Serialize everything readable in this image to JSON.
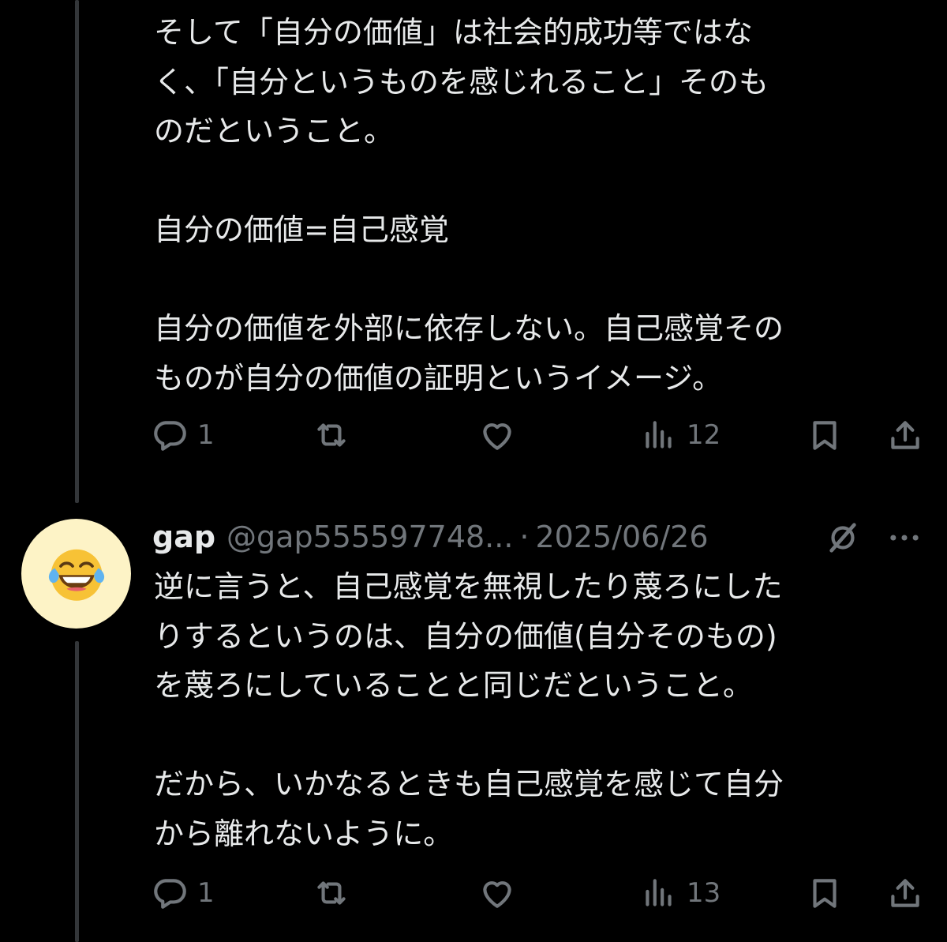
{
  "posts": [
    {
      "text": "そして「自分の価値」は社会的成功等ではな\nく、「自分というものを感じれること」そのも\nのだということ。\n\n自分の価値=自己感覚\n\n自分の価値を外部に依存しない。自己感覚その\nものが自分の価値の証明というイメージ。",
      "replies": "1",
      "views": "12"
    },
    {
      "author": {
        "display_name": "gap",
        "handle": "@gap555597748...",
        "separator": "·",
        "date": "2025/06/26",
        "avatar_icon": "face-with-tears-of-joy-emoji"
      },
      "text": "逆に言うと、自己感覚を無視したり蔑ろにした\nりするというのは、自分の価値(自分そのもの)\nを蔑ろにしていることと同じだということ。\n\nだから、いかなるときも自己感覚を感じて自分\nから離れないように。",
      "replies": "1",
      "views": "13"
    }
  ],
  "icons": {
    "reply": "reply-icon",
    "repost": "repost-icon",
    "like": "heart-icon",
    "views": "views-bar-chart-icon",
    "bookmark": "bookmark-icon",
    "share": "share-icon",
    "grok": "grok-icon",
    "more": "more-dots-icon"
  },
  "colors": {
    "background": "#000000",
    "text": "#e7e9ea",
    "muted": "#71767b",
    "thread_line": "#333639"
  }
}
